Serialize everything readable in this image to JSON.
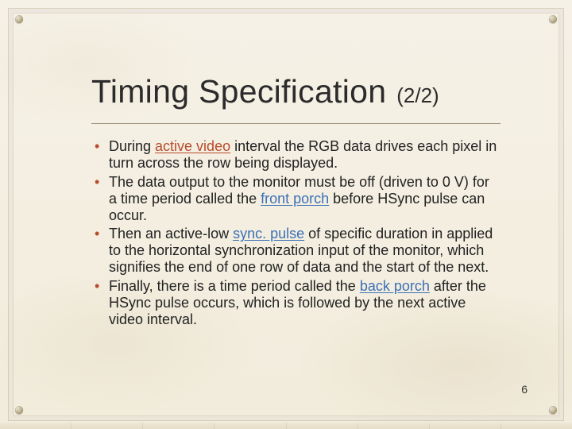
{
  "title": {
    "main": "Timing Specification",
    "counter": "(2/2)"
  },
  "bullets": [
    {
      "pre": "During ",
      "hl": "active video",
      "hlClass": "hl-red",
      "post": " interval the RGB data drives each pixel in turn across the row being displayed."
    },
    {
      "pre": "The data output to the monitor must be off (driven to 0 V) for a time period called the ",
      "hl": "front porch",
      "hlClass": "hl-blue",
      "post": " before HSync pulse can occur."
    },
    {
      "pre": "Then an active-low ",
      "hl": "sync. pulse",
      "hlClass": "hl-blue",
      "post": " of specific duration in applied to the horizontal synchronization input of the monitor, which signifies the end of one row of data and the start of the next."
    },
    {
      "pre": "Finally, there is a time period called the ",
      "hl": "back porch",
      "hlClass": "hl-blue",
      "post": " after the HSync pulse occurs, which is followed by the next active video interval."
    }
  ],
  "pageNumber": "6"
}
